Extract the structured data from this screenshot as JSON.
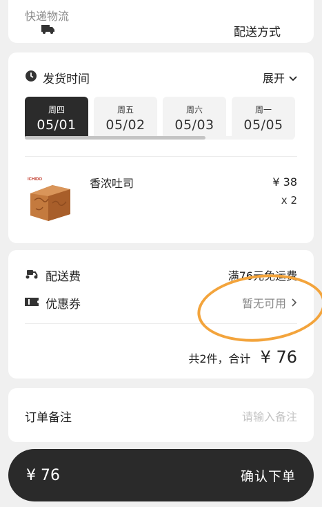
{
  "delivery": {
    "label": "配送方式",
    "value": "快递物流",
    "icon": "truck-icon"
  },
  "shipping": {
    "label": "发货时间",
    "expand_label": "展开",
    "icon": "clock-icon",
    "dates": [
      {
        "weekday": "周四",
        "date": "05/01",
        "selected": true
      },
      {
        "weekday": "周五",
        "date": "05/02",
        "selected": false
      },
      {
        "weekday": "周六",
        "date": "05/03",
        "selected": false
      },
      {
        "weekday": "周一",
        "date": "05/05",
        "selected": false
      }
    ]
  },
  "product": {
    "brand_mark": "ICHIDO",
    "name": "香浓吐司",
    "price": "¥ 38",
    "quantity": "x 2"
  },
  "fees": {
    "shipping_label": "配送费",
    "shipping_value": "满76元免运费",
    "coupon_label": "优惠券",
    "coupon_value": "暂无可用",
    "summary": "共2件，合计",
    "total": "¥ 76"
  },
  "remark": {
    "label": "订单备注",
    "placeholder": "请输入备注"
  },
  "footer": {
    "price": "¥ 76",
    "confirm_label": "确认下单"
  },
  "colors": {
    "annotation_ring": "#f3a43c",
    "dark": "#2a2a2a",
    "background": "#f0f0f0"
  }
}
